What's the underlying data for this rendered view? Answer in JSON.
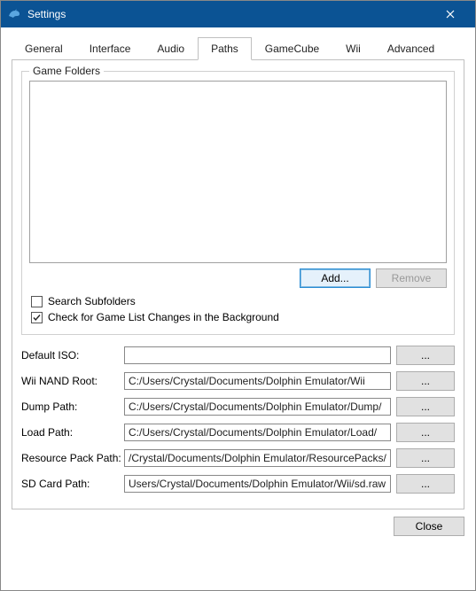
{
  "window": {
    "title": "Settings"
  },
  "tabs": {
    "general": "General",
    "interface": "Interface",
    "audio": "Audio",
    "paths": "Paths",
    "gamecube": "GameCube",
    "wii": "Wii",
    "advanced": "Advanced"
  },
  "group": {
    "gameFolders": "Game Folders"
  },
  "buttons": {
    "add": "Add...",
    "remove": "Remove",
    "browse": "...",
    "close": "Close"
  },
  "checkboxes": {
    "searchSubfolders": {
      "label": "Search Subfolders",
      "checked": false
    },
    "checkBackground": {
      "label": "Check for Game List Changes in the Background",
      "checked": true
    }
  },
  "paths": {
    "defaultIso": {
      "label": "Default ISO:",
      "value": ""
    },
    "wiiNandRoot": {
      "label": "Wii NAND Root:",
      "value": "C:/Users/Crystal/Documents/Dolphin Emulator/Wii"
    },
    "dumpPath": {
      "label": "Dump Path:",
      "value": "C:/Users/Crystal/Documents/Dolphin Emulator/Dump/"
    },
    "loadPath": {
      "label": "Load Path:",
      "value": "C:/Users/Crystal/Documents/Dolphin Emulator/Load/"
    },
    "resourcePack": {
      "label": "Resource Pack Path:",
      "value": "/Crystal/Documents/Dolphin Emulator/ResourcePacks/"
    },
    "sdCardPath": {
      "label": "SD Card Path:",
      "value": "Users/Crystal/Documents/Dolphin Emulator/Wii/sd.raw"
    }
  }
}
